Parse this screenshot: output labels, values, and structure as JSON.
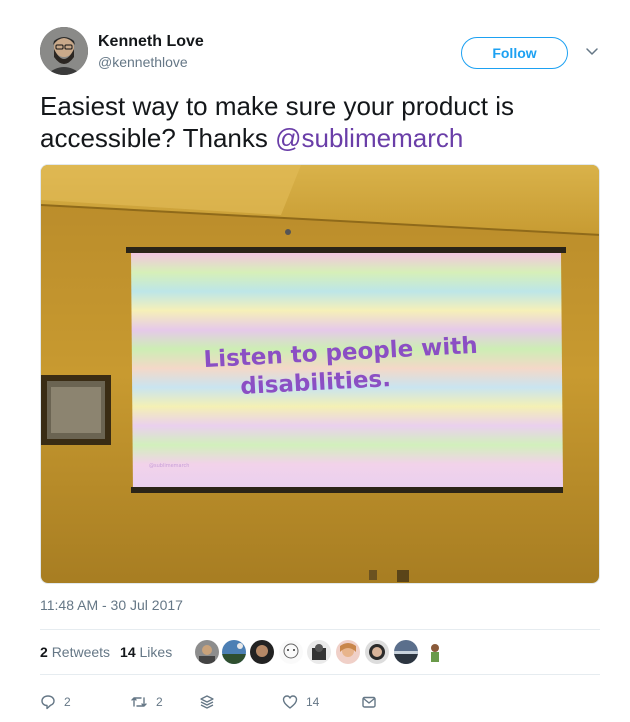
{
  "author": {
    "name": "Kenneth Love",
    "handle": "@kennethlove"
  },
  "follow_label": "Follow",
  "tweet": {
    "text_prefix": "Easiest way to make sure your product is accessible? Thanks ",
    "mention": "@sublimemarch"
  },
  "photo": {
    "slide_line1": "Listen to people with",
    "slide_line2": "disabilities.",
    "slide_footer": "@sublimemarch"
  },
  "timestamp": "11:48 AM - 30 Jul 2017",
  "stats": {
    "retweets_count": "2",
    "retweets_label": "Retweets",
    "likes_count": "14",
    "likes_label": "Likes"
  },
  "actions": {
    "reply_count": "2",
    "retweet_count": "2",
    "like_count": "14"
  },
  "icons": {
    "reply": "reply-icon",
    "retweet": "retweet-icon",
    "stack": "stack-icon",
    "like": "heart-icon",
    "dm": "envelope-icon",
    "chevron": "chevron-down-icon"
  },
  "colors": {
    "brand_blue": "#1da1f2",
    "mention": "#6a3ea8",
    "slide_text": "#8b4fc4"
  }
}
